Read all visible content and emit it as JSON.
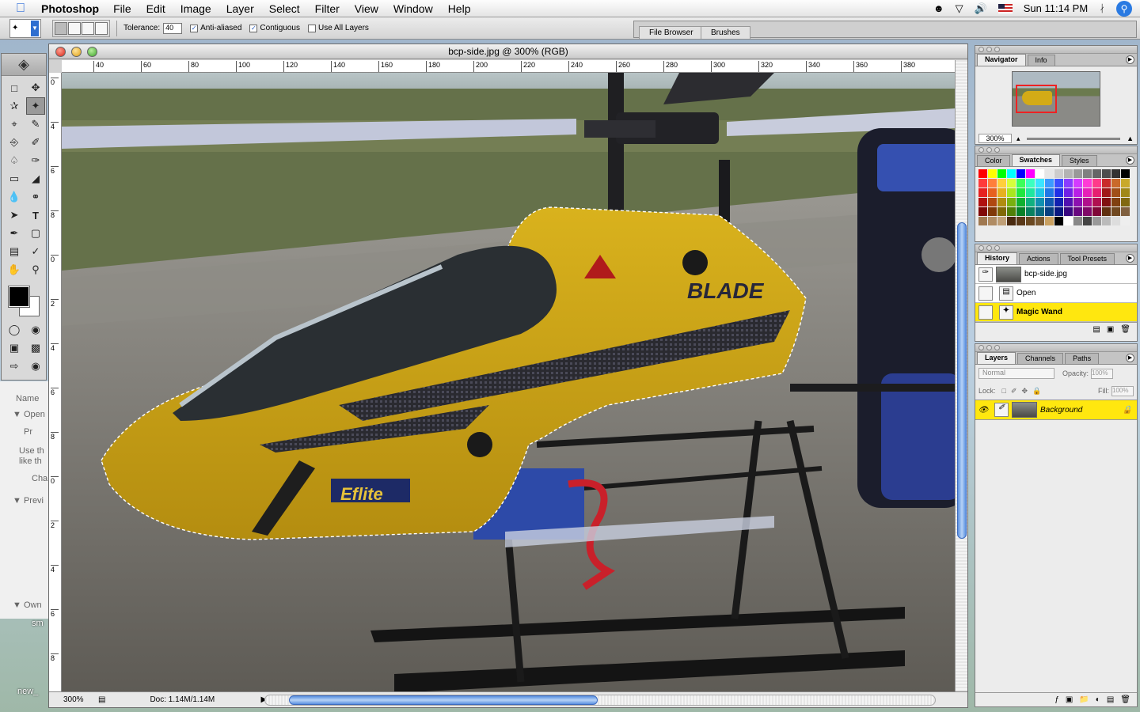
{
  "menubar": {
    "app": "Photoshop",
    "items": [
      "File",
      "Edit",
      "Image",
      "Layer",
      "Select",
      "Filter",
      "View",
      "Window",
      "Help"
    ],
    "clock": "Sun 11:14 PM"
  },
  "options": {
    "tolerance_label": "Tolerance:",
    "tolerance_value": "40",
    "anti_aliased": "Anti-aliased",
    "contiguous": "Contiguous",
    "use_all_layers": "Use All Layers"
  },
  "well": {
    "file_browser": "File Browser",
    "brushes": "Brushes"
  },
  "document": {
    "title": "bcp-side.jpg @ 300% (RGB)",
    "zoom": "300%",
    "doc_info": "Doc: 1.14M/1.14M",
    "ruler_h": [
      "40",
      "60",
      "80",
      "100",
      "120",
      "140",
      "160",
      "180",
      "200",
      "220",
      "240",
      "260",
      "280",
      "300",
      "320",
      "340",
      "360",
      "380"
    ],
    "ruler_v": [
      "0",
      "4",
      "6",
      "8",
      "0",
      "2",
      "4",
      "6",
      "8",
      "0",
      "2",
      "4",
      "6",
      "8"
    ]
  },
  "bgwindow": {
    "items": [
      "Name",
      "▼ Open",
      "Pr",
      "Use th",
      "like th",
      "Cha",
      "▼ Previ",
      "▼ Own"
    ]
  },
  "desktop": {
    "label_1": "sm",
    "label_2": "new_"
  },
  "navigator": {
    "tab_active": "Navigator",
    "tab_2": "Info",
    "zoom": "300%"
  },
  "swatches": {
    "tab_1": "Color",
    "tab_active": "Swatches",
    "tab_3": "Styles",
    "colors": [
      "#ff0000",
      "#ffff00",
      "#00ff00",
      "#00ffff",
      "#0000ff",
      "#ff00ff",
      "#ffffff",
      "#e6e6e6",
      "#cccccc",
      "#b3b3b3",
      "#999999",
      "#808080",
      "#666666",
      "#4d4d4d",
      "#333333",
      "#000000",
      "#ff3b3b",
      "#ff7f3b",
      "#ffcf3b",
      "#d6ff3b",
      "#3bff5a",
      "#3bffc0",
      "#3be6ff",
      "#3b9aff",
      "#3b4eff",
      "#8a3bff",
      "#d43bff",
      "#ff3bd6",
      "#ff3b8a",
      "#c92a2a",
      "#c96a2a",
      "#c9a92a",
      "#e62020",
      "#e66020",
      "#e6b020",
      "#a8e620",
      "#20e640",
      "#20e6a0",
      "#20c8e6",
      "#2078e6",
      "#2030e6",
      "#7020e6",
      "#b820e6",
      "#e620b8",
      "#e62070",
      "#a01818",
      "#a05018",
      "#a08818",
      "#b01010",
      "#b04810",
      "#b08c10",
      "#78b010",
      "#10b030",
      "#10b080",
      "#1090b0",
      "#1058b0",
      "#1020b0",
      "#5010b0",
      "#8c10b0",
      "#b0108c",
      "#b01050",
      "#801010",
      "#804010",
      "#806810",
      "#800808",
      "#803808",
      "#806808",
      "#508008",
      "#088028",
      "#088060",
      "#086880",
      "#084080",
      "#081880",
      "#380880",
      "#680880",
      "#800868",
      "#800838",
      "#603010",
      "#704820",
      "#806040",
      "#a07850",
      "#b08c64",
      "#c0a078",
      "#4a2a10",
      "#5a3818",
      "#6a4820",
      "#7a5830",
      "#c9a060",
      "#000000",
      "#ffffff",
      "#888888",
      "#444444",
      "#999999",
      "#bbbbbb",
      "#dddddd",
      "#eeeeee"
    ]
  },
  "history": {
    "tab_active": "History",
    "tab_2": "Actions",
    "tab_3": "Tool Presets",
    "snapshot": "bcp-side.jpg",
    "steps": [
      "Open",
      "Magic Wand"
    ]
  },
  "layers": {
    "tab_active": "Layers",
    "tab_2": "Channels",
    "tab_3": "Paths",
    "blend": "Normal",
    "opacity_label": "Opacity:",
    "opacity": "100%",
    "lock_label": "Lock:",
    "fill_label": "Fill:",
    "fill": "100%",
    "layer_name": "Background"
  }
}
